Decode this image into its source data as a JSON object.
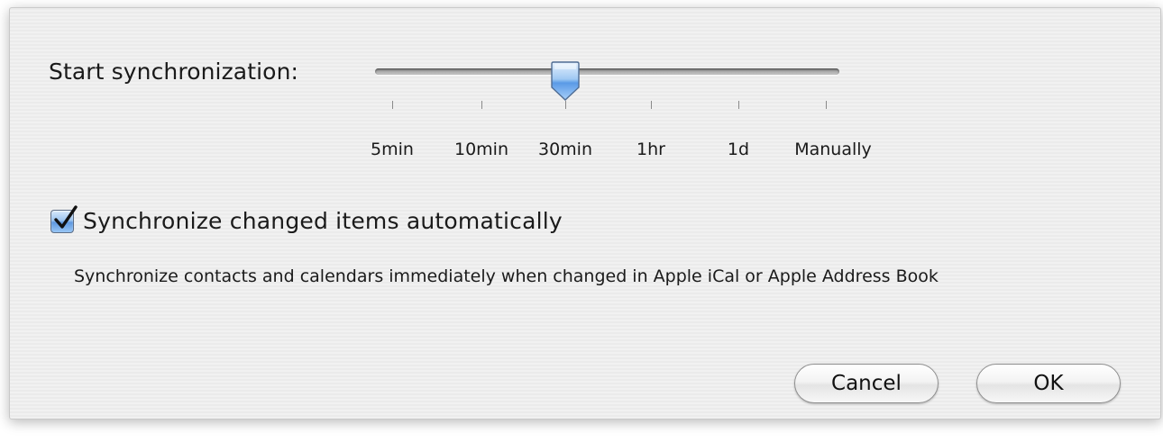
{
  "sync": {
    "start_label": "Start synchronization:",
    "slider": {
      "options": [
        "5min",
        "10min",
        "30min",
        "1hr",
        "1d",
        "Manually"
      ],
      "selected_index": 2,
      "selected_value": "30min"
    }
  },
  "auto_sync": {
    "checked": true,
    "label": "Synchronize changed items automatically",
    "description": "Synchronize contacts and calendars immediately when changed in Apple iCal or Apple Address Book"
  },
  "buttons": {
    "cancel_label": "Cancel",
    "ok_label": "OK"
  },
  "colors": {
    "thumb_accent": "#5a9ae6",
    "checkbox_accent": "#5f98e0"
  },
  "icons": {
    "checkbox": "checkmark-icon",
    "slider_thumb": "slider-thumb-pointer"
  }
}
